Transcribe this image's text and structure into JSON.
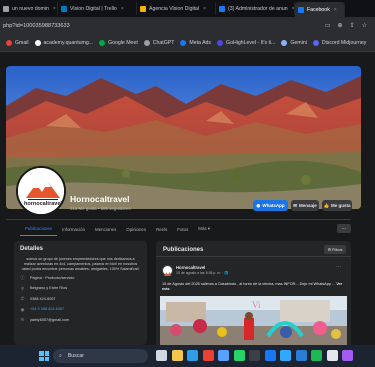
{
  "browser": {
    "tabs": [
      {
        "label": "un nuevo domin",
        "color": "#9aa0a6",
        "active": false
      },
      {
        "label": "Vision Digital | Trello",
        "color": "#0079bf",
        "active": false
      },
      {
        "label": "Agencia Vision Digital",
        "color": "#f4b400",
        "active": false
      },
      {
        "label": "(3) Administrador de anun",
        "color": "#1877f2",
        "active": false
      },
      {
        "label": "Facebook",
        "color": "#1877f2",
        "active": true
      }
    ],
    "url": "php?id=100035988733633",
    "bookmarks": [
      {
        "label": "Gmail",
        "color": "#ea4335"
      },
      {
        "label": "academy.quantumg...",
        "color": "#ffffff"
      },
      {
        "label": "Google Meet",
        "color": "#00ac47"
      },
      {
        "label": "ChatGPT",
        "color": "#9aa0a6"
      },
      {
        "label": "Meta Ads",
        "color": "#1877f2"
      },
      {
        "label": "GoHighLevel - It's ti...",
        "color": "#4f46e5"
      },
      {
        "label": "Gemini",
        "color": "#8ab4f8"
      },
      {
        "label": "Discord Midjourney",
        "color": "#5865f2"
      }
    ]
  },
  "profile": {
    "name": "Hornocaltravel",
    "stats": "315 Me gusta • 585 seguidores",
    "avatar_text": "hornocaltravel",
    "buttons": {
      "whatsapp": "WhatsApp",
      "message": "Mensaje",
      "like": "Me gusta"
    }
  },
  "nav": {
    "tabs": [
      "Publicaciones",
      "Información",
      "Menciones",
      "Opiniones",
      "Reels",
      "Fotos",
      "Más ▾"
    ],
    "more": "···"
  },
  "details": {
    "title": "Detalles",
    "bio": "somos un grupo de jovenes emprendedores que nos dedicamos a realizar aventuras en 4x4, campamentos, paseos en bici! en nosotros usted podra encontrar personas amables, amigables, 100% Salamiños!!",
    "rows": [
      {
        "icon": "info-icon",
        "glyph": "ⓘ",
        "text": "Página · Producto/servicio",
        "link": false
      },
      {
        "icon": "location-icon",
        "glyph": "⚲",
        "text": "Belgrano y Entre Ríos",
        "link": false
      },
      {
        "icon": "phone-icon",
        "glyph": "✆",
        "text": "0388 424-6057",
        "link": false
      },
      {
        "icon": "whatsapp-icon",
        "glyph": "◉",
        "text": "+54 9 388 424-6057",
        "link": true
      },
      {
        "icon": "email-icon",
        "glyph": "✉",
        "text": "yalely6057@gmail.com",
        "link": false
      }
    ]
  },
  "posts": {
    "title": "Publicaciones",
    "filters": "⚙ Filtros",
    "post": {
      "author": "Hornocaltravel",
      "meta": "15 de agosto a las 5:38 p. m. · 🌐",
      "text": "15 de Agosto del 2025 salimos a Casabindo , al toreo de la vincha, mas INFOR... Dejo mi WhatsApp ... ",
      "see_more": "Ver más",
      "dots": "···"
    }
  },
  "taskbar": {
    "search": "Buscar",
    "icons": [
      {
        "name": "task-view-icon",
        "color": "#cfd8e3"
      },
      {
        "name": "file-explorer-icon",
        "color": "#f2c94c"
      },
      {
        "name": "edge-icon",
        "color": "#2f9ee8"
      },
      {
        "name": "chrome-icon",
        "color": "#e94235"
      },
      {
        "name": "store-icon",
        "color": "#5aa0ff"
      },
      {
        "name": "whatsapp-icon",
        "color": "#25d366"
      },
      {
        "name": "terminal-icon",
        "color": "#3b3f46"
      },
      {
        "name": "facebook-icon",
        "color": "#1877f2"
      },
      {
        "name": "photoshop-icon",
        "color": "#31a8ff"
      },
      {
        "name": "word-icon",
        "color": "#2b7cd3"
      },
      {
        "name": "spotify-icon",
        "color": "#1db954"
      },
      {
        "name": "capcut-icon",
        "color": "#e3e6ea"
      },
      {
        "name": "app-icon",
        "color": "#a25cf2"
      }
    ]
  }
}
